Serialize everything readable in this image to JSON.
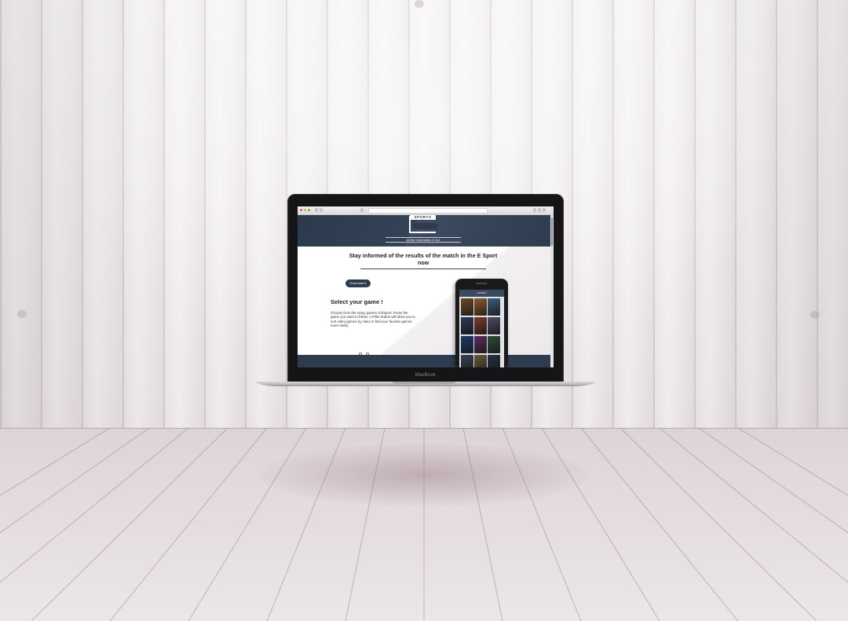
{
  "browser": {
    "title": ""
  },
  "site": {
    "logo_text": "SPORTS",
    "tagline": "All the information in live",
    "headline": "Stay informed of the results of the match in the E Sport now",
    "download_label": "Download it",
    "select_title": "Select your game !",
    "select_description": "Choose from the many games of Esport. Press the game you want to follow. A Filter button will allow you to sort video games by class to find your favorite games more easily.",
    "carousel": {
      "total": 3,
      "active": 1
    }
  },
  "phone": {
    "bar_title": "GAMES",
    "tiles": [
      "#6b4a2a",
      "#8a5a2f",
      "#3f5a7a",
      "#2b3a55",
      "#7a3b2c",
      "#4d4d62",
      "#1f3b6a",
      "#5a2f5e",
      "#2f4a3a",
      "#3a3f55",
      "#6a5a3a",
      "#283040"
    ]
  },
  "device": {
    "brand_label": "MacBook"
  },
  "colors": {
    "navy": "#2f3b4e",
    "wall": "#ece7e9"
  }
}
